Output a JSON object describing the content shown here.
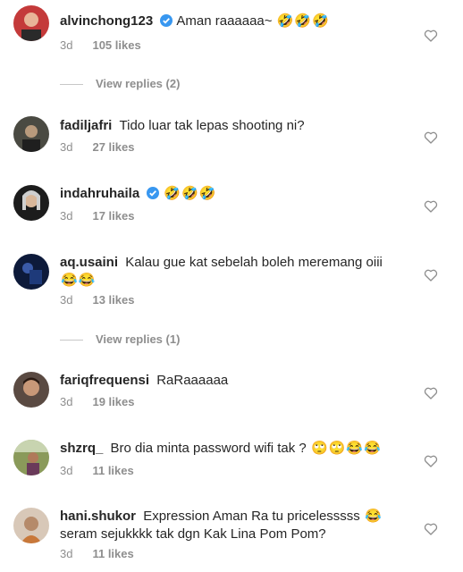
{
  "comments": [
    {
      "username": "alvinchong123",
      "verified": true,
      "text": "Aman raaaaaa~",
      "emojis": [
        "🤣",
        "🤣",
        "🤣"
      ],
      "text2": "",
      "time": "3d",
      "likes": "105 likes"
    },
    {
      "username": "fadiljafri",
      "verified": false,
      "text": "Tido luar tak lepas shooting ni?",
      "emojis": [],
      "text2": "",
      "time": "3d",
      "likes": "27 likes"
    },
    {
      "username": "indahruhaila",
      "verified": true,
      "text": "",
      "emojis": [
        "🤣",
        "🤣",
        "🤣"
      ],
      "text2": "",
      "time": "3d",
      "likes": "17 likes"
    },
    {
      "username": "aq.usaini",
      "verified": false,
      "text": "Kalau gue kat sebelah boleh meremang oiii",
      "emojis": [
        "😂",
        "😂"
      ],
      "text2": "",
      "time": "3d",
      "likes": "13 likes"
    },
    {
      "username": "fariqfrequensi",
      "verified": false,
      "text": "RaRaaaaaa",
      "emojis": [],
      "text2": "",
      "time": "3d",
      "likes": "19 likes"
    },
    {
      "username": "shzrq_",
      "verified": false,
      "text": "Bro dia minta password wifi tak ?",
      "emojis": [
        "🙄",
        "🙄",
        "😂",
        "😂"
      ],
      "text2": "",
      "time": "3d",
      "likes": "11 likes"
    },
    {
      "username": "hani.shukor",
      "verified": false,
      "text": "Expression Aman Ra tu pricelesssss",
      "emojis": [
        "😂"
      ],
      "text2": "seram sejukkkk tak dgn Kak Lina Pom Pom?",
      "time": "3d",
      "likes": "11 likes"
    }
  ],
  "view_replies": [
    "View replies (2)",
    "View replies (1)"
  ],
  "colors": {
    "verified": "#3897f0",
    "muted": "#8e8e8e",
    "text": "#262626"
  },
  "icons": {
    "like": "heart-outline-icon",
    "verified": "verified-badge-icon"
  }
}
